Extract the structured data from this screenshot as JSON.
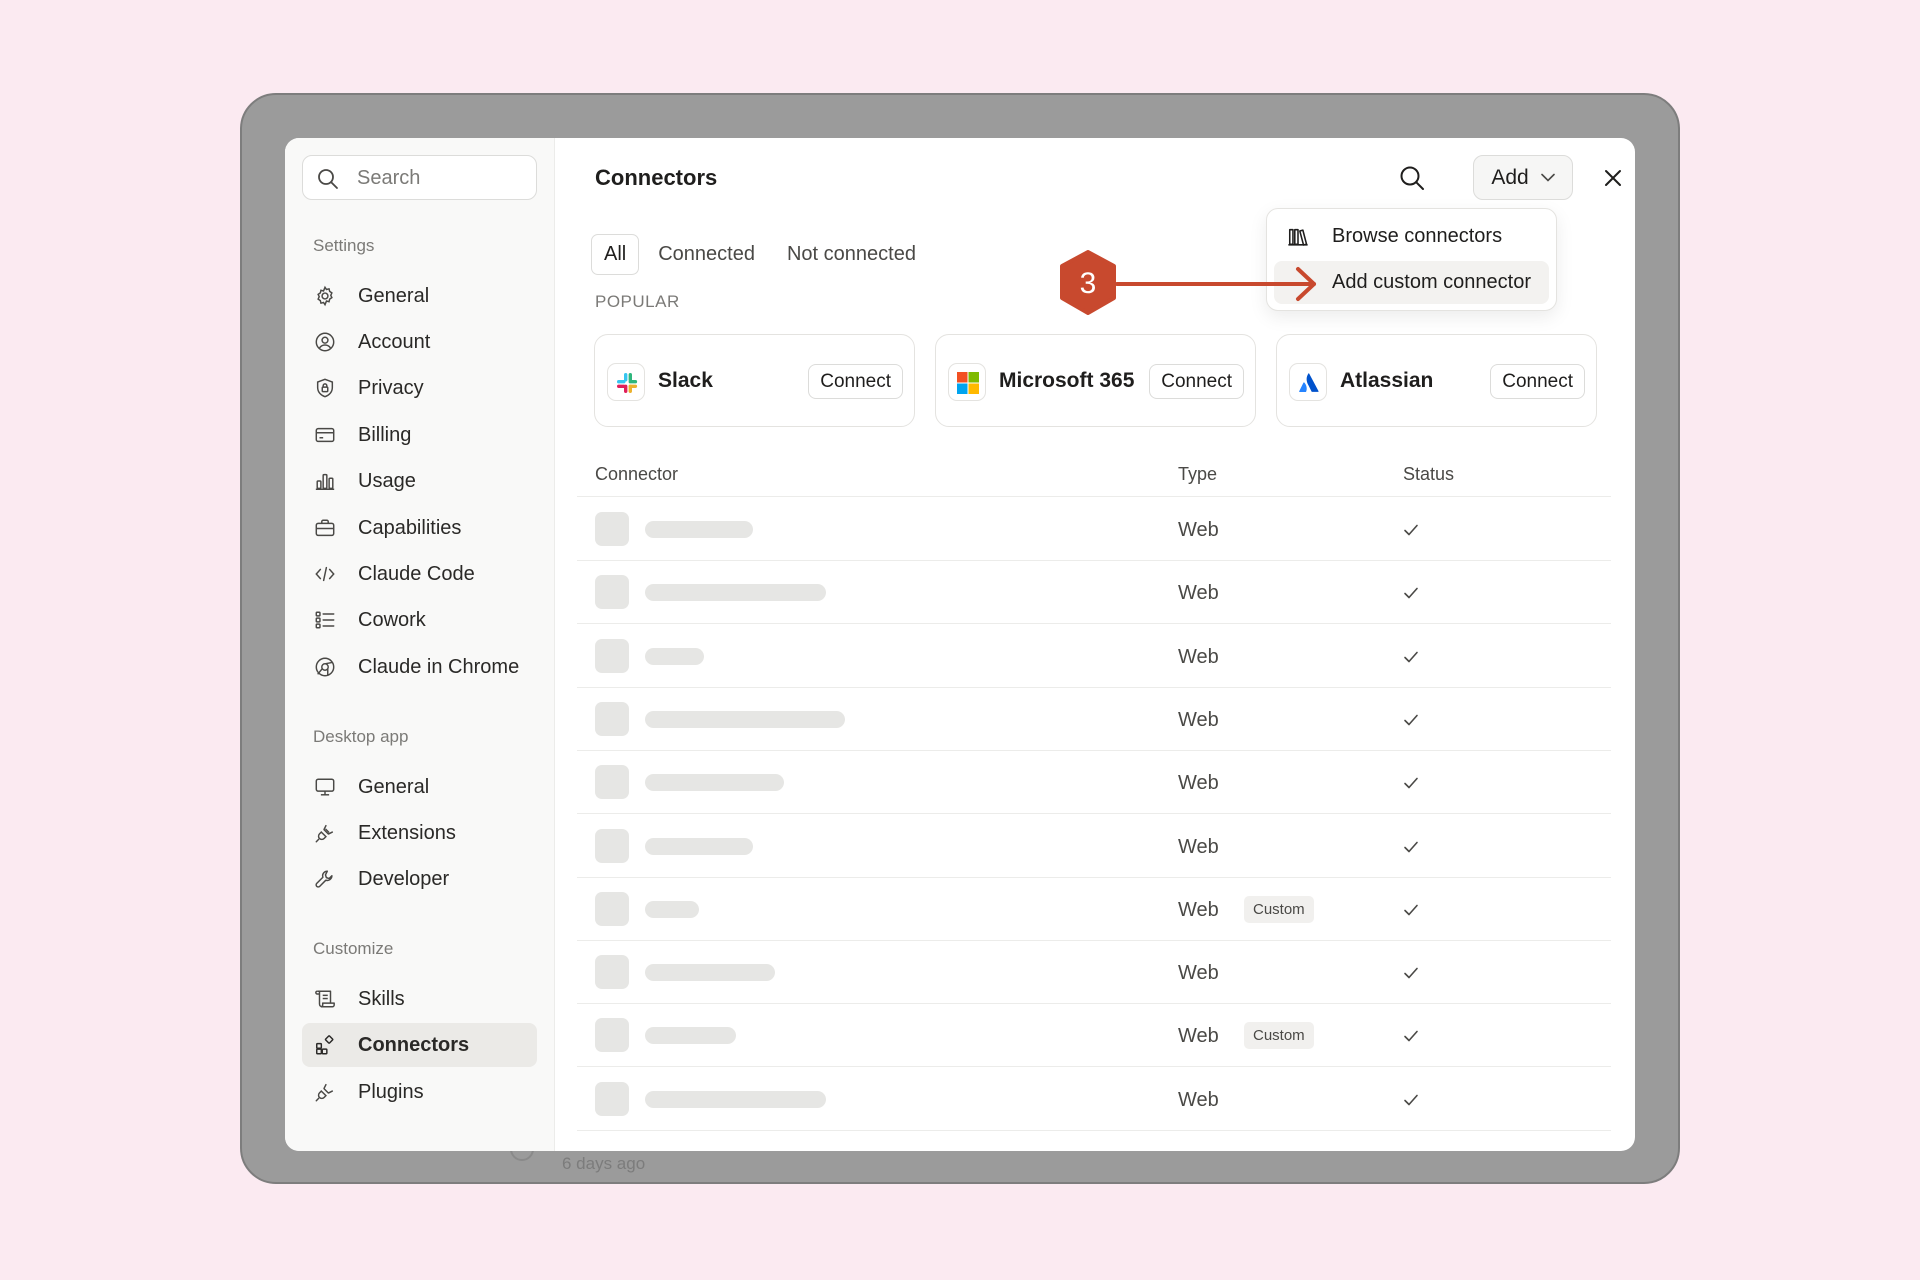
{
  "background_ghost": {
    "label": "6 days ago"
  },
  "sidebar": {
    "search": {
      "placeholder": "Search",
      "value": ""
    },
    "sections": [
      {
        "label": "Settings",
        "items": [
          {
            "label": "General",
            "icon": "gear-icon"
          },
          {
            "label": "Account",
            "icon": "user-circle-icon"
          },
          {
            "label": "Privacy",
            "icon": "shield-lock-icon"
          },
          {
            "label": "Billing",
            "icon": "credit-card-icon"
          },
          {
            "label": "Usage",
            "icon": "bar-chart-icon"
          },
          {
            "label": "Capabilities",
            "icon": "briefcase-icon"
          },
          {
            "label": "Claude Code",
            "icon": "code-icon"
          },
          {
            "label": "Cowork",
            "icon": "checklist-icon"
          },
          {
            "label": "Claude in Chrome",
            "icon": "globe-icon"
          }
        ]
      },
      {
        "label": "Desktop app",
        "items": [
          {
            "label": "General",
            "icon": "monitor-icon"
          },
          {
            "label": "Extensions",
            "icon": "plug-icon"
          },
          {
            "label": "Developer",
            "icon": "wrench-icon"
          }
        ]
      },
      {
        "label": "Customize",
        "items": [
          {
            "label": "Skills",
            "icon": "scroll-icon"
          },
          {
            "label": "Connectors",
            "icon": "connectors-icon",
            "active": true
          },
          {
            "label": "Plugins",
            "icon": "plug-icon"
          }
        ]
      }
    ]
  },
  "main": {
    "title": "Connectors",
    "add_button": "Add",
    "tabs": [
      {
        "label": "All",
        "active": true
      },
      {
        "label": "Connected",
        "active": false
      },
      {
        "label": "Not connected",
        "active": false
      }
    ],
    "popular_label": "POPULAR",
    "popular": [
      {
        "name": "Slack",
        "button": "Connect",
        "icon": "slack-icon"
      },
      {
        "name": "Microsoft 365",
        "button": "Connect",
        "icon": "microsoft-icon"
      },
      {
        "name": "Atlassian",
        "button": "Connect",
        "icon": "atlassian-icon"
      }
    ],
    "table": {
      "columns": [
        "Connector",
        "Type",
        "Status"
      ],
      "rows": [
        {
          "type": "Web",
          "badge": "",
          "status": "check"
        },
        {
          "type": "Web",
          "badge": "",
          "status": "check"
        },
        {
          "type": "Web",
          "badge": "",
          "status": "check"
        },
        {
          "type": "Web",
          "badge": "",
          "status": "check"
        },
        {
          "type": "Web",
          "badge": "",
          "status": "check"
        },
        {
          "type": "Web",
          "badge": "",
          "status": "check"
        },
        {
          "type": "Web",
          "badge": "Custom",
          "status": "check"
        },
        {
          "type": "Web",
          "badge": "",
          "status": "check"
        },
        {
          "type": "Web",
          "badge": "Custom",
          "status": "check"
        },
        {
          "type": "Web",
          "badge": "",
          "status": "check"
        }
      ]
    }
  },
  "dropdown": {
    "items": [
      {
        "label": "Browse connectors",
        "icon": "library-icon"
      },
      {
        "label": "Add custom connector",
        "icon": "",
        "highlighted": true
      }
    ]
  },
  "annotation": {
    "step_number": "3",
    "color": "#c8492e"
  },
  "colors": {
    "page_background": "#fbeaf1",
    "frame": "#9b9b9b",
    "sidebar_background": "#f9f9f8",
    "active_item": "#ebeae7",
    "placeholder_bar": "#e6e6e4"
  }
}
